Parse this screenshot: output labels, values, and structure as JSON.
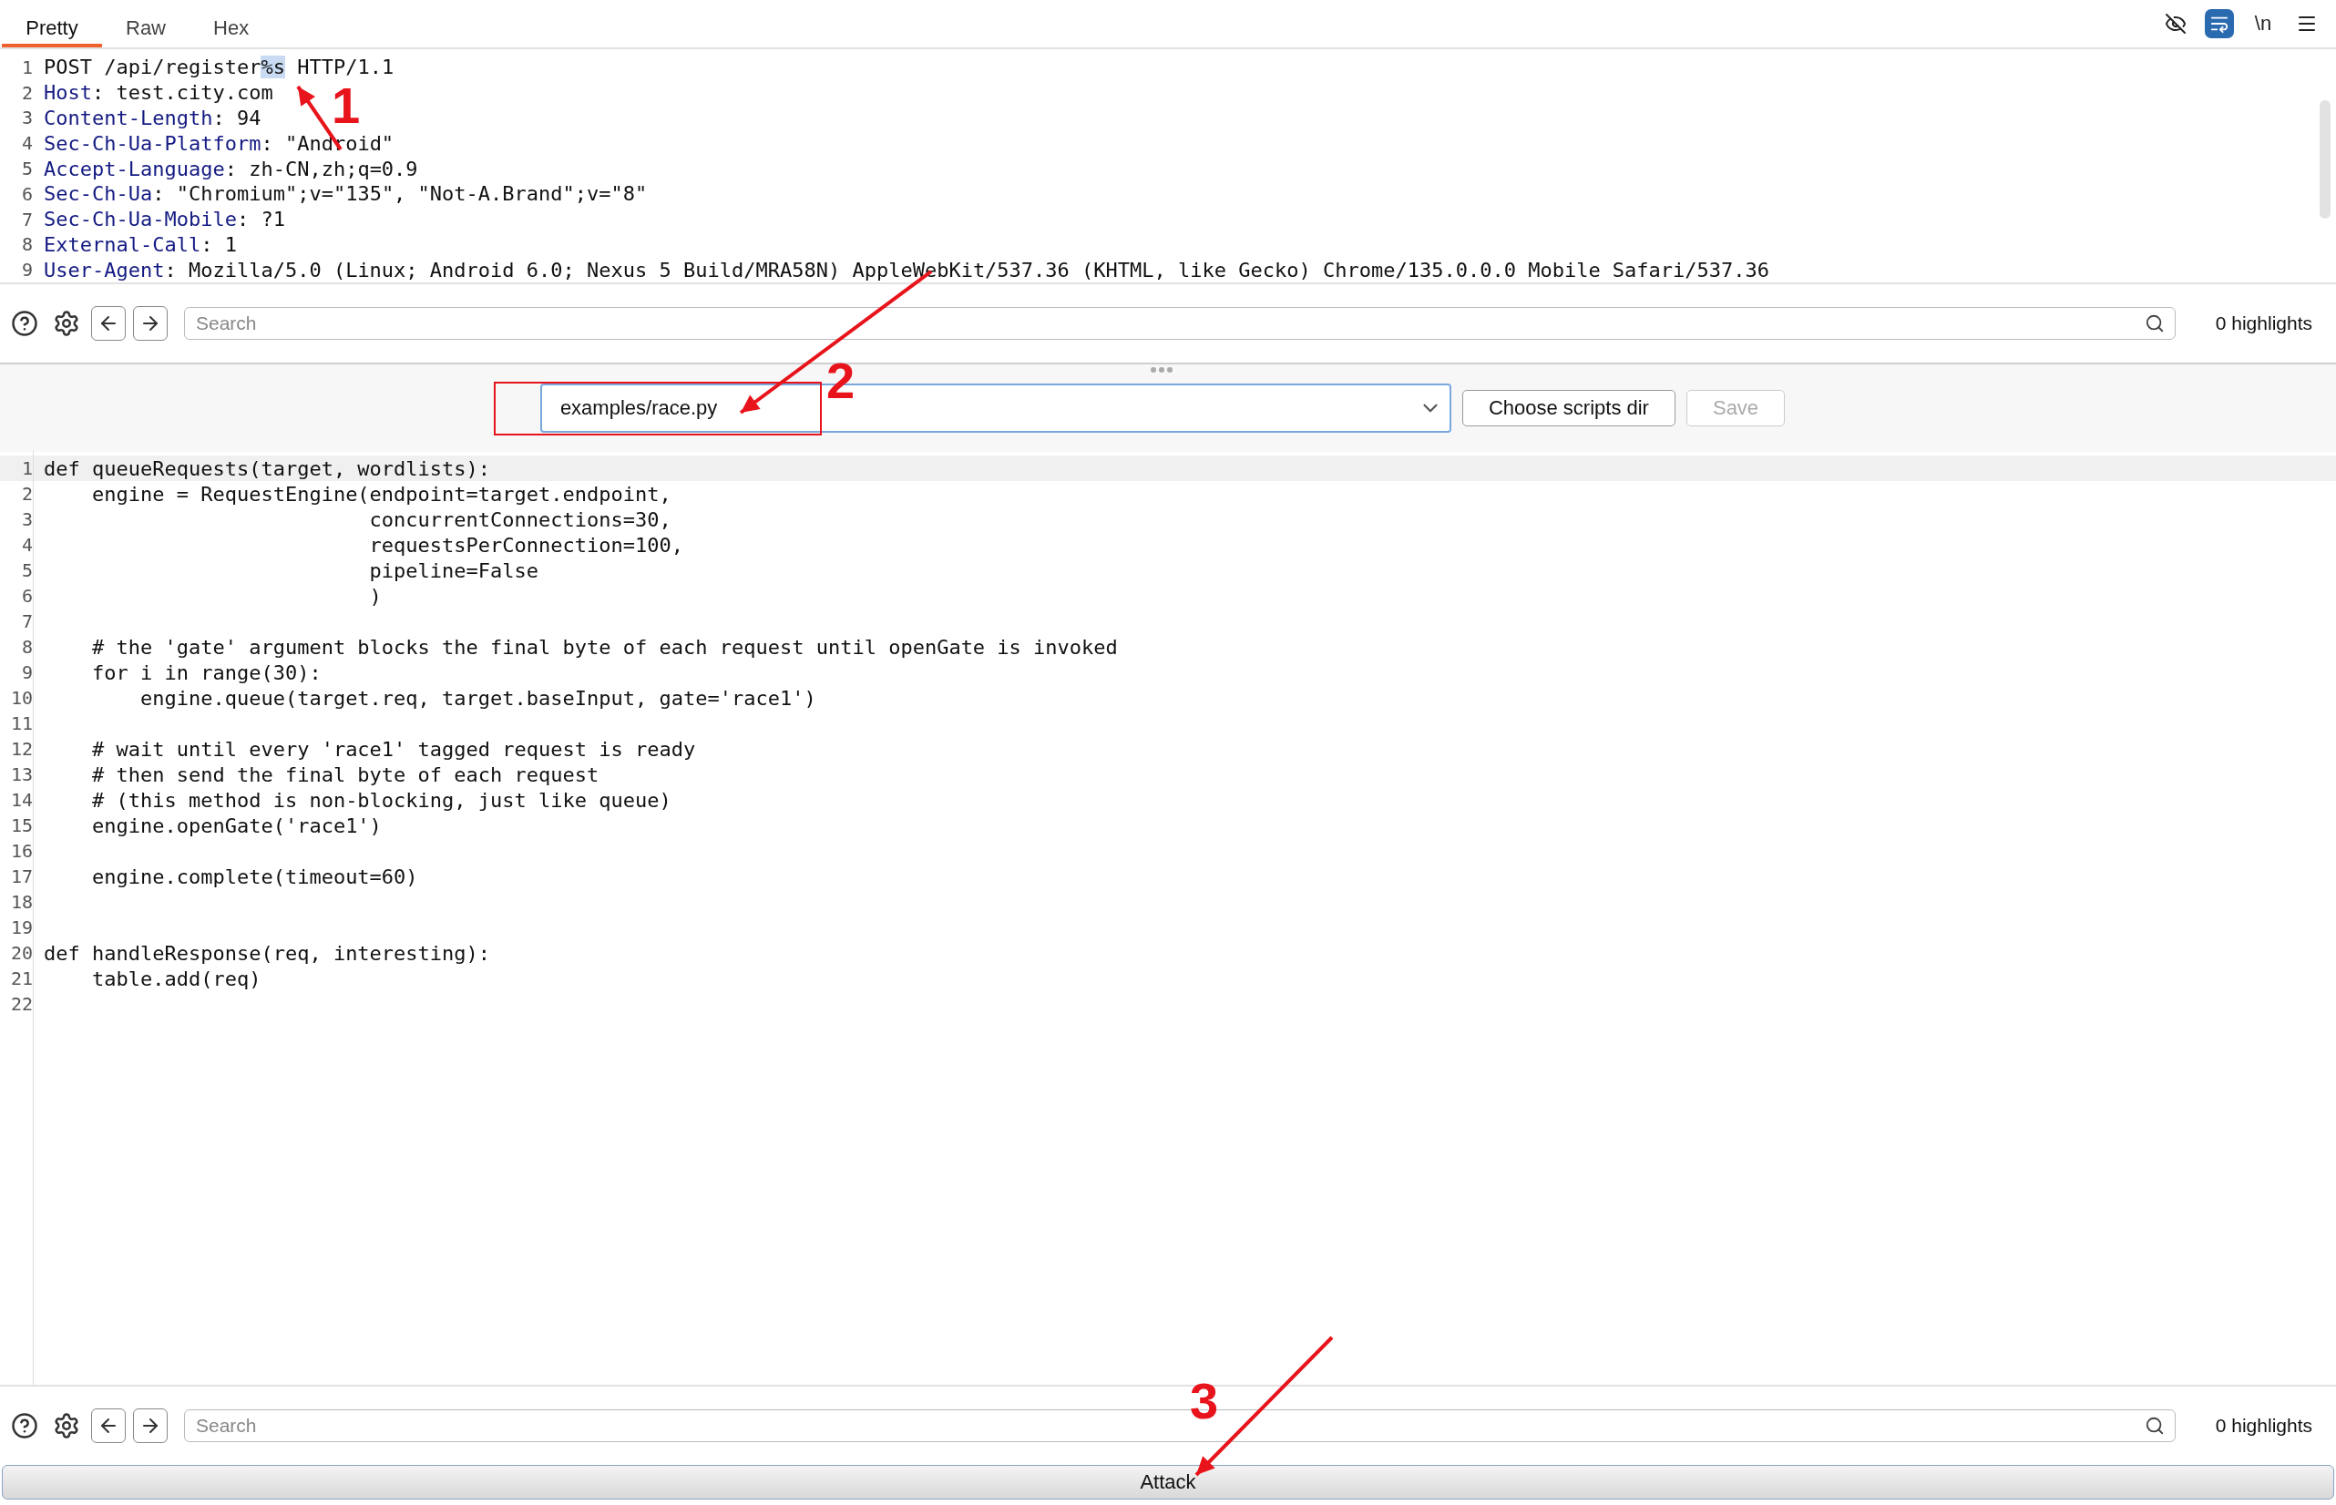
{
  "tabs": [
    {
      "label": "Pretty",
      "selected": true
    },
    {
      "label": "Raw",
      "selected": false
    },
    {
      "label": "Hex",
      "selected": false
    }
  ],
  "view_toggles": [
    {
      "kind": "hide",
      "on": false
    },
    {
      "kind": "wrap",
      "on": true
    },
    {
      "kind": "newline",
      "label": "\\n",
      "on": false
    },
    {
      "kind": "menu",
      "on": false
    }
  ],
  "request_lines": [
    {
      "number": "1",
      "segments": [
        {
          "kind": "plain",
          "text": "POST /api/register"
        },
        {
          "kind": "selected",
          "text": "%s"
        },
        {
          "kind": "plain",
          "text": " HTTP/1.1"
        }
      ]
    },
    {
      "number": "2",
      "segments": [
        {
          "kind": "header",
          "text": "Host"
        },
        {
          "kind": "plain",
          "text": ": test.city.com"
        }
      ]
    },
    {
      "number": "3",
      "segments": [
        {
          "kind": "header",
          "text": "Content-Length"
        },
        {
          "kind": "plain",
          "text": ": 94"
        }
      ]
    },
    {
      "number": "4",
      "segments": [
        {
          "kind": "header",
          "text": "Sec-Ch-Ua-Platform"
        },
        {
          "kind": "plain",
          "text": ": \"Android\""
        }
      ]
    },
    {
      "number": "5",
      "segments": [
        {
          "kind": "header",
          "text": "Accept-Language"
        },
        {
          "kind": "plain",
          "text": ": zh-CN,zh;q=0.9"
        }
      ]
    },
    {
      "number": "6",
      "segments": [
        {
          "kind": "header",
          "text": "Sec-Ch-Ua"
        },
        {
          "kind": "plain",
          "text": ": \"Chromium\";v=\"135\", \"Not-A.Brand\";v=\"8\""
        }
      ]
    },
    {
      "number": "7",
      "segments": [
        {
          "kind": "header",
          "text": "Sec-Ch-Ua-Mobile"
        },
        {
          "kind": "plain",
          "text": ": ?1"
        }
      ]
    },
    {
      "number": "8",
      "segments": [
        {
          "kind": "header",
          "text": "External-Call"
        },
        {
          "kind": "plain",
          "text": ": 1"
        }
      ]
    },
    {
      "number": "9",
      "segments": [
        {
          "kind": "header",
          "text": "User-Agent"
        },
        {
          "kind": "plain",
          "text": ": Mozilla/5.0 (Linux; Android 6.0; Nexus 5 Build/MRA58N) AppleWebKit/537.36 (KHTML, like Gecko) Chrome/135.0.0.0 Mobile Safari/537.36"
        }
      ]
    }
  ],
  "request_search": {
    "placeholder": "Search",
    "highlights": "0 highlights"
  },
  "script_select": {
    "value": "examples/race.py",
    "buttons": [
      {
        "label": "Choose scripts dir",
        "disabled": false
      },
      {
        "label": "Save",
        "disabled": true
      }
    ]
  },
  "code_lines": [
    {
      "number": "1",
      "text": "def queueRequests(target, wordlists):",
      "current": true
    },
    {
      "number": "2",
      "text": "    engine = RequestEngine(endpoint=target.endpoint,",
      "current": false
    },
    {
      "number": "3",
      "text": "                           concurrentConnections=30,",
      "current": false
    },
    {
      "number": "4",
      "text": "                           requestsPerConnection=100,",
      "current": false
    },
    {
      "number": "5",
      "text": "                           pipeline=False",
      "current": false
    },
    {
      "number": "6",
      "text": "                           )",
      "current": false
    },
    {
      "number": "7",
      "current": false
    },
    {
      "number": "8",
      "text": "    # the 'gate' argument blocks the final byte of each request until openGate is invoked",
      "current": false
    },
    {
      "number": "9",
      "text": "    for i in range(30):",
      "current": false
    },
    {
      "number": "10",
      "text": "        engine.queue(target.req, target.baseInput, gate='race1')",
      "current": false
    },
    {
      "number": "11",
      "current": false
    },
    {
      "number": "12",
      "text": "    # wait until every 'race1' tagged request is ready",
      "current": false
    },
    {
      "number": "13",
      "text": "    # then send the final byte of each request",
      "current": false
    },
    {
      "number": "14",
      "text": "    # (this method is non-blocking, just like queue)",
      "current": false
    },
    {
      "number": "15",
      "text": "    engine.openGate('race1')",
      "current": false
    },
    {
      "number": "16",
      "current": false
    },
    {
      "number": "17",
      "text": "    engine.complete(timeout=60)",
      "current": false
    },
    {
      "number": "18",
      "current": false
    },
    {
      "number": "19",
      "current": false
    },
    {
      "number": "20",
      "text": "def handleResponse(req, interesting):",
      "current": false
    },
    {
      "number": "21",
      "text": "    table.add(req)",
      "current": false
    },
    {
      "number": "22",
      "current": false
    }
  ],
  "code_search": {
    "placeholder": "Search",
    "highlights": "0 highlights"
  },
  "attack_button": {
    "label": "Attack"
  },
  "annotations": [
    {
      "label": "1"
    },
    {
      "label": "2"
    },
    {
      "label": "3"
    }
  ]
}
